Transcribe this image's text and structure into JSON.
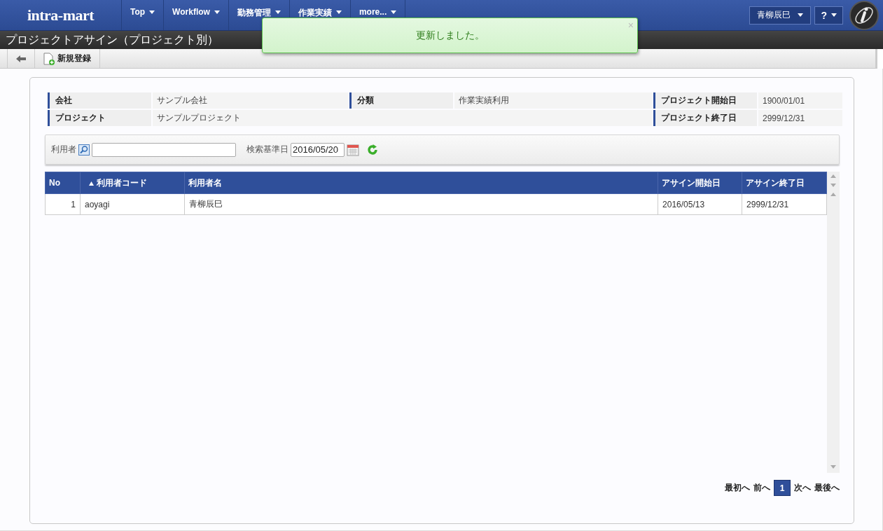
{
  "header": {
    "logo": "intra-mart",
    "nav": [
      {
        "label": "Top"
      },
      {
        "label": "Workflow"
      },
      {
        "label": "勤務管理"
      },
      {
        "label": "作業実績"
      },
      {
        "label": "more..."
      }
    ],
    "user": "青柳辰巳",
    "help": "?"
  },
  "title": "プロジェクトアサイン（プロジェクト別）",
  "toolbar": {
    "new_label": "新規登録"
  },
  "toast": {
    "message": "更新しました。",
    "close": "×"
  },
  "info": [
    {
      "label": "会社",
      "value": "サンプル会社"
    },
    {
      "label": "分類",
      "value": "作業実績利用"
    },
    {
      "label": "プロジェクト開始日",
      "value": "1900/01/01"
    },
    {
      "label": "プロジェクト",
      "value": "サンプルプロジェクト"
    },
    {
      "label": "プロジェクト終了日",
      "value": "2999/12/31"
    }
  ],
  "search": {
    "user_label": "利用者",
    "date_label": "検索基準日",
    "date_value": "2016/05/20"
  },
  "table": {
    "columns": [
      {
        "label": "No",
        "sorted": false
      },
      {
        "label": "利用者コード",
        "sorted": true
      },
      {
        "label": "利用者名",
        "sorted": false
      },
      {
        "label": "アサイン開始日",
        "sorted": false
      },
      {
        "label": "アサイン終了日",
        "sorted": false
      }
    ],
    "rows": [
      [
        "1",
        "aoyagi",
        "青柳辰巳",
        "2016/05/13",
        "2999/12/31"
      ]
    ]
  },
  "pager": {
    "first": "最初へ",
    "prev": "前へ",
    "pages": [
      {
        "label": "1",
        "selected": true
      }
    ],
    "next": "次へ",
    "last": "最後へ"
  }
}
